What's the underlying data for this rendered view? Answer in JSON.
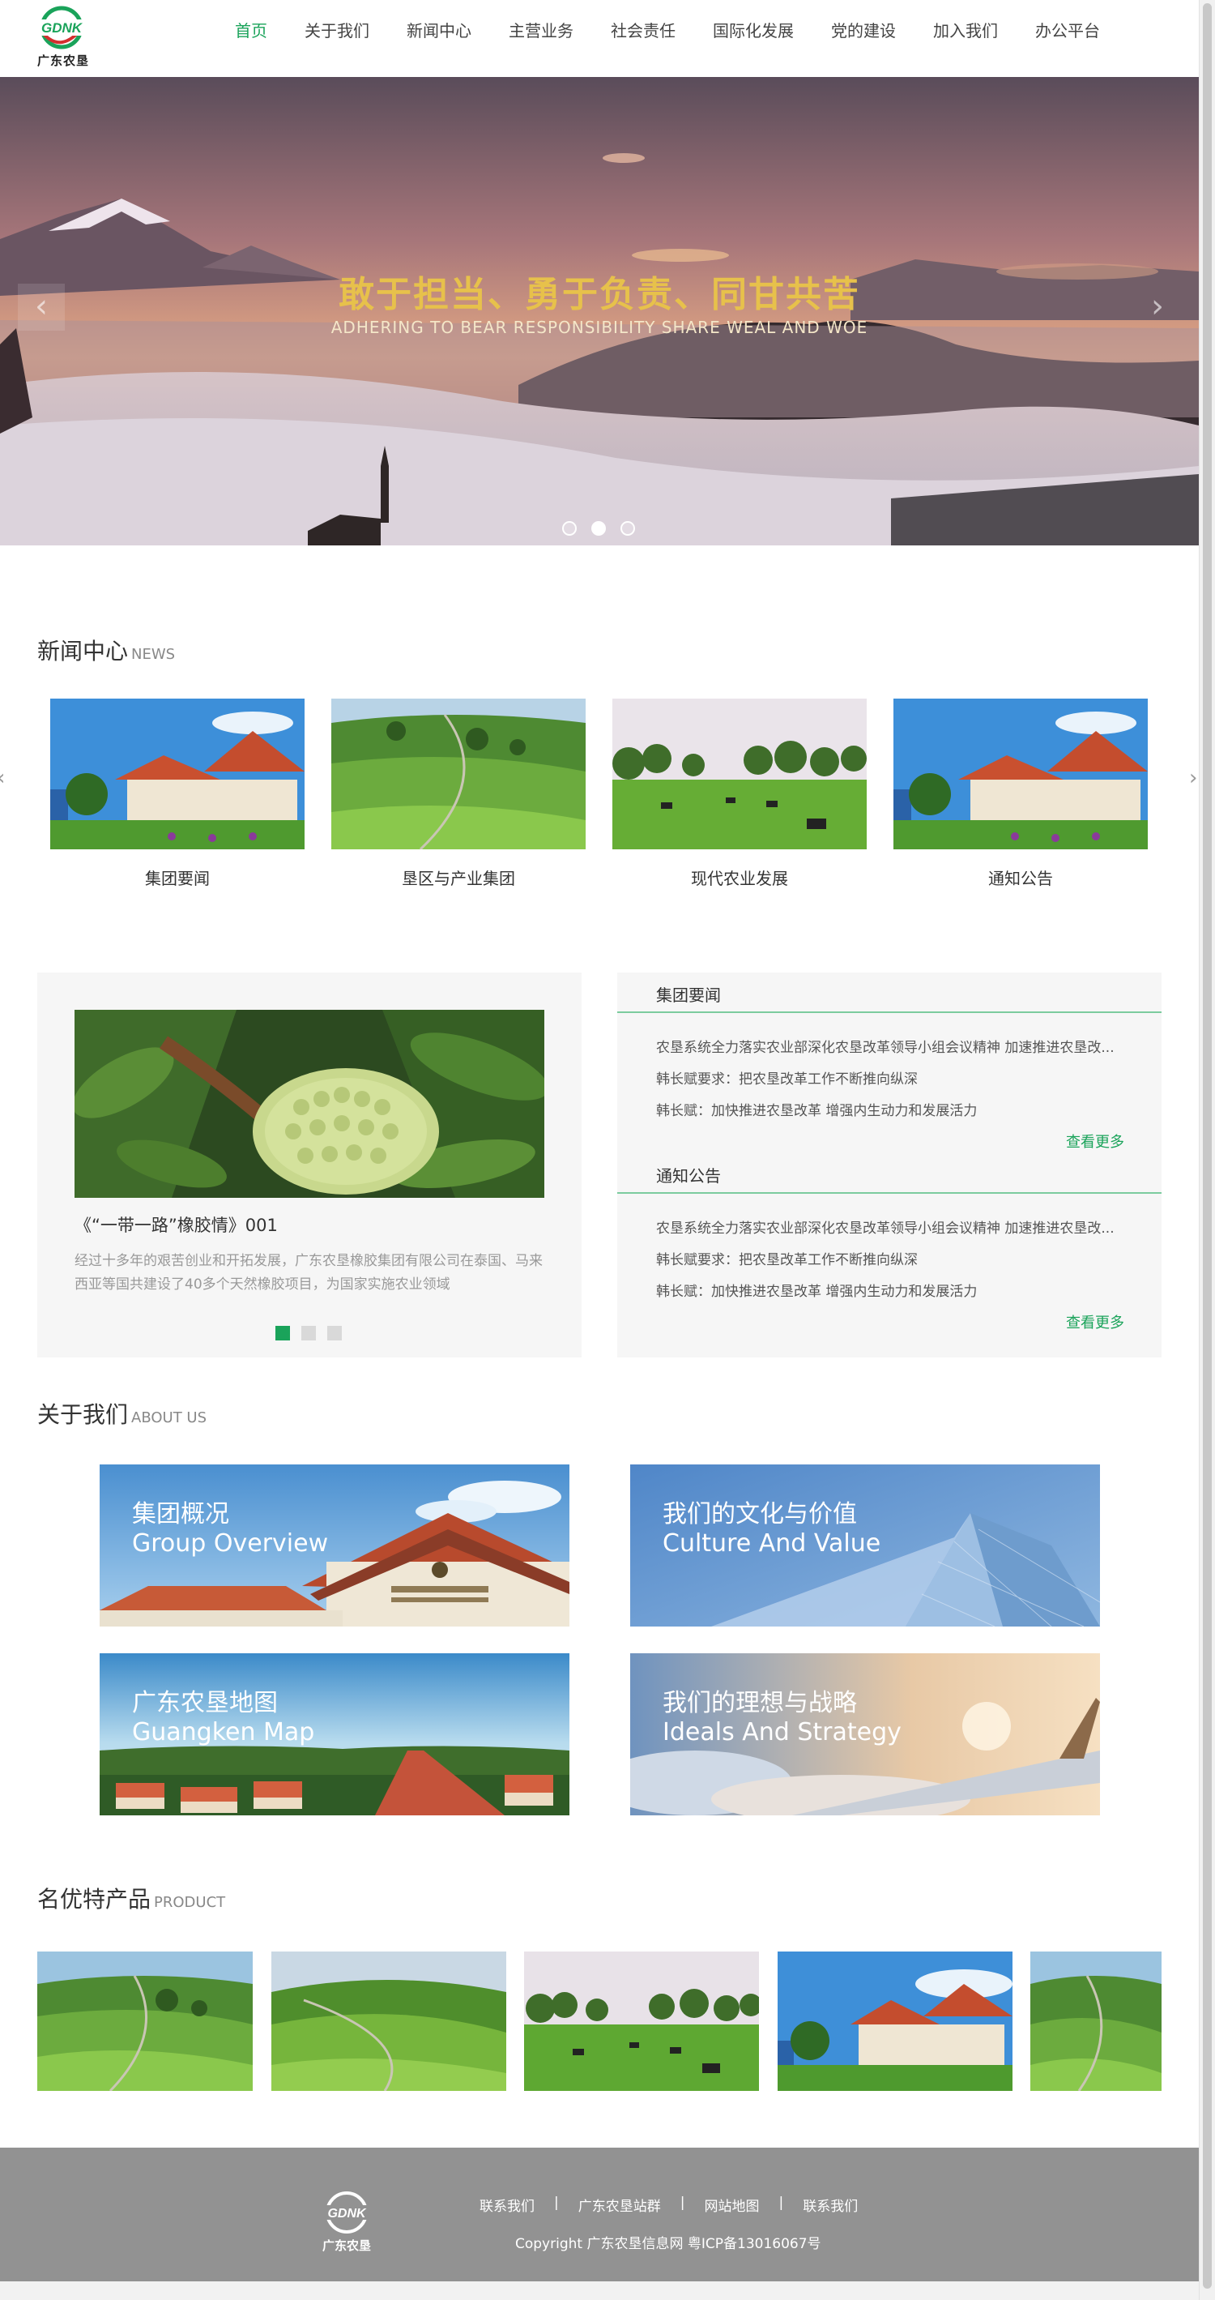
{
  "header": {
    "logo_text": "广东农垦",
    "logo_mark": "GDNK",
    "nav": [
      "首页",
      "关于我们",
      "新闻中心",
      "主营业务",
      "社会责任",
      "国际化发展",
      "党的建设",
      "加入我们",
      "办公平台"
    ],
    "active_index": 0
  },
  "banner": {
    "title": "敢于担当、勇于负责、同甘共苦",
    "subtitle": "ADHERING TO BEAR RESPONSIBILITY SHARE WEAL AND WOE",
    "prev_icon": "‹",
    "next_icon": "›",
    "slides": 3,
    "active_slide": 1
  },
  "news": {
    "title": "新闻中心",
    "title_en": "NEWS",
    "cards": [
      {
        "label": "集团要闻",
        "image": "building"
      },
      {
        "label": "垦区与产业集团",
        "image": "hills"
      },
      {
        "label": "现代农业发展",
        "image": "pasture"
      },
      {
        "label": "通知公告",
        "image": "building"
      }
    ]
  },
  "feature": {
    "caption": "《“一带一路”橡胶情》001",
    "desc": "经过十多年的艰苦创业和开拓发展，广东农垦橡胶集团有限公司在泰国、马来西亚等国共建设了40多个天然橡胶项目，为国家实施农业领域",
    "pages": 3,
    "active_page": 0
  },
  "lists": [
    {
      "head": "集团要闻",
      "items": [
        "农垦系统全力落实农业部深化农垦改革领导小组会议精神 加速推进农垦改...",
        "韩长赋要求：把农垦改革工作不断推向纵深",
        "韩长赋：加快推进农垦改革 增强内生动力和发展活力"
      ],
      "more": "查看更多"
    },
    {
      "head": "通知公告",
      "items": [
        "农垦系统全力落实农业部深化农垦改革领导小组会议精神 加速推进农垦改...",
        "韩长赋要求：把农垦改革工作不断推向纵深",
        "韩长赋：加快推进农垦改革 增强内生动力和发展活力"
      ],
      "more": "查看更多"
    }
  ],
  "about": {
    "title": "关于我们",
    "title_en": "ABOUT US",
    "tiles": [
      {
        "cn": "集团概况",
        "en": "Group Overview"
      },
      {
        "cn": "我们的文化与价值",
        "en": "Culture And Value"
      },
      {
        "cn": "广东农垦地图",
        "en": "Guangken Map"
      },
      {
        "cn": "我们的理想与战略",
        "en": "Ideals And Strategy"
      }
    ]
  },
  "products": {
    "title": "名优特产品",
    "title_en": "PRODUCT"
  },
  "footer": {
    "logo_text": "广东农垦",
    "links": [
      "联系我们",
      "广东农垦站群",
      "网站地图",
      "联系我们"
    ],
    "separator": "|",
    "copyright": "Copyright 广东农垦信息网 粤ICP备13016067号"
  },
  "colors": {
    "accent": "#1aa35a",
    "banner_title": "#e7c14b",
    "footer_bg": "#929292"
  }
}
